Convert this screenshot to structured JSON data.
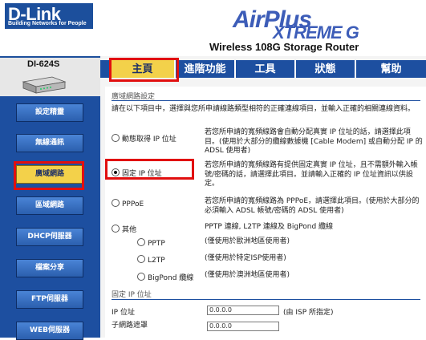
{
  "header": {
    "brand": "D-Link",
    "brand_tagline": "Building Networks for People",
    "airplus": "AirPlus",
    "xtreme": "XTREME G",
    "product": "Wireless 108G Storage Router"
  },
  "sidebar": {
    "model": "DI-624S",
    "items": [
      {
        "label": "設定精靈"
      },
      {
        "label": "無線通訊"
      },
      {
        "label": "廣域網路",
        "active": true
      },
      {
        "label": "區域網路"
      },
      {
        "label": "DHCP伺服器"
      },
      {
        "label": "檔案分享"
      },
      {
        "label": "FTP伺服器"
      },
      {
        "label": "WEB伺服器"
      }
    ]
  },
  "tabs": [
    {
      "label": "主頁",
      "active": true
    },
    {
      "label": "進階功能"
    },
    {
      "label": "工具"
    },
    {
      "label": "狀態"
    },
    {
      "label": "幫助"
    }
  ],
  "wan": {
    "section_title": "廣域網路設定",
    "intro": "請在以下項目中，選擇與您所申請線路類型相符的正確連線項目，並輸入正確的相關連線資料。",
    "options": [
      {
        "label": "動態取得 IP 位址",
        "selected": false,
        "desc": "若您所申請的寬頻線路會自動分配真實 IP 位址的話，請選擇此項目。(使用於大部分的纜線數據機 [Cable Modem] 或自動分配 IP 的 ADSL 使用者)"
      },
      {
        "label": "固定 IP 位址",
        "selected": true,
        "desc": "若您所申請的寬頻線路有提供固定真實 IP 位址，且不需額外輸入帳號/密碼的話，請選擇此項目。並請輸入正確的 IP 位址資訊以供設定。"
      },
      {
        "label": "PPPoE",
        "selected": false,
        "desc": "若您所申請的寬頻線路為 PPPoE，請選擇此項目。(使用於大部分的必須輸入 ADSL 帳號/密碼的 ADSL 使用者)"
      },
      {
        "label": "其他",
        "selected": false,
        "desc": "PPTP 連線, L2TP 連線及 BigPond 纜線"
      }
    ],
    "sub_options": [
      {
        "label": "PPTP",
        "desc": "(僅使用於歐洲地區使用者)"
      },
      {
        "label": "L2TP",
        "desc": "(僅使用於特定ISP使用者)"
      },
      {
        "label": "BigPond 纜線",
        "desc": "(僅使用於澳洲地區使用者)"
      }
    ]
  },
  "static_ip": {
    "section_title": "固定 IP 位址",
    "ip_label": "IP 位址",
    "ip_value": "0.0.0.0",
    "ip_hint": "(由 ISP 所指定)",
    "mask_label": "子網路遮罩",
    "mask_value": "0.0.0.0"
  },
  "colors": {
    "nav_blue": "#1d4fa0",
    "active_yellow": "#f3d14a",
    "highlight_red": "#e10f0f"
  }
}
